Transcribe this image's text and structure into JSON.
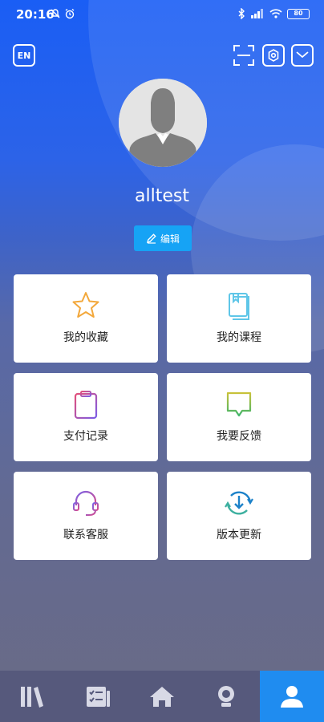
{
  "status_bar": {
    "time": "20:16",
    "battery": "80"
  },
  "header": {
    "language_label": "EN"
  },
  "profile": {
    "username": "alltest",
    "edit_label": "编辑"
  },
  "menu": {
    "items": [
      {
        "label": "我的收藏",
        "icon": "star-icon"
      },
      {
        "label": "我的课程",
        "icon": "book-icon"
      },
      {
        "label": "支付记录",
        "icon": "clipboard-icon"
      },
      {
        "label": "我要反馈",
        "icon": "feedback-icon"
      },
      {
        "label": "联系客服",
        "icon": "headset-icon"
      },
      {
        "label": "版本更新",
        "icon": "update-icon"
      }
    ]
  },
  "tabbar": {
    "items": [
      {
        "icon": "library-icon",
        "active": false
      },
      {
        "icon": "tasks-icon",
        "active": false
      },
      {
        "icon": "home-icon",
        "active": false
      },
      {
        "icon": "lightbulb-icon",
        "active": false
      },
      {
        "icon": "profile-icon",
        "active": true
      }
    ]
  },
  "colors": {
    "primary_blue": "#1a5ef5",
    "edit_button": "#16a3f5",
    "active_tab": "#1f8cf0",
    "tabbar_bg": "#56597c"
  }
}
